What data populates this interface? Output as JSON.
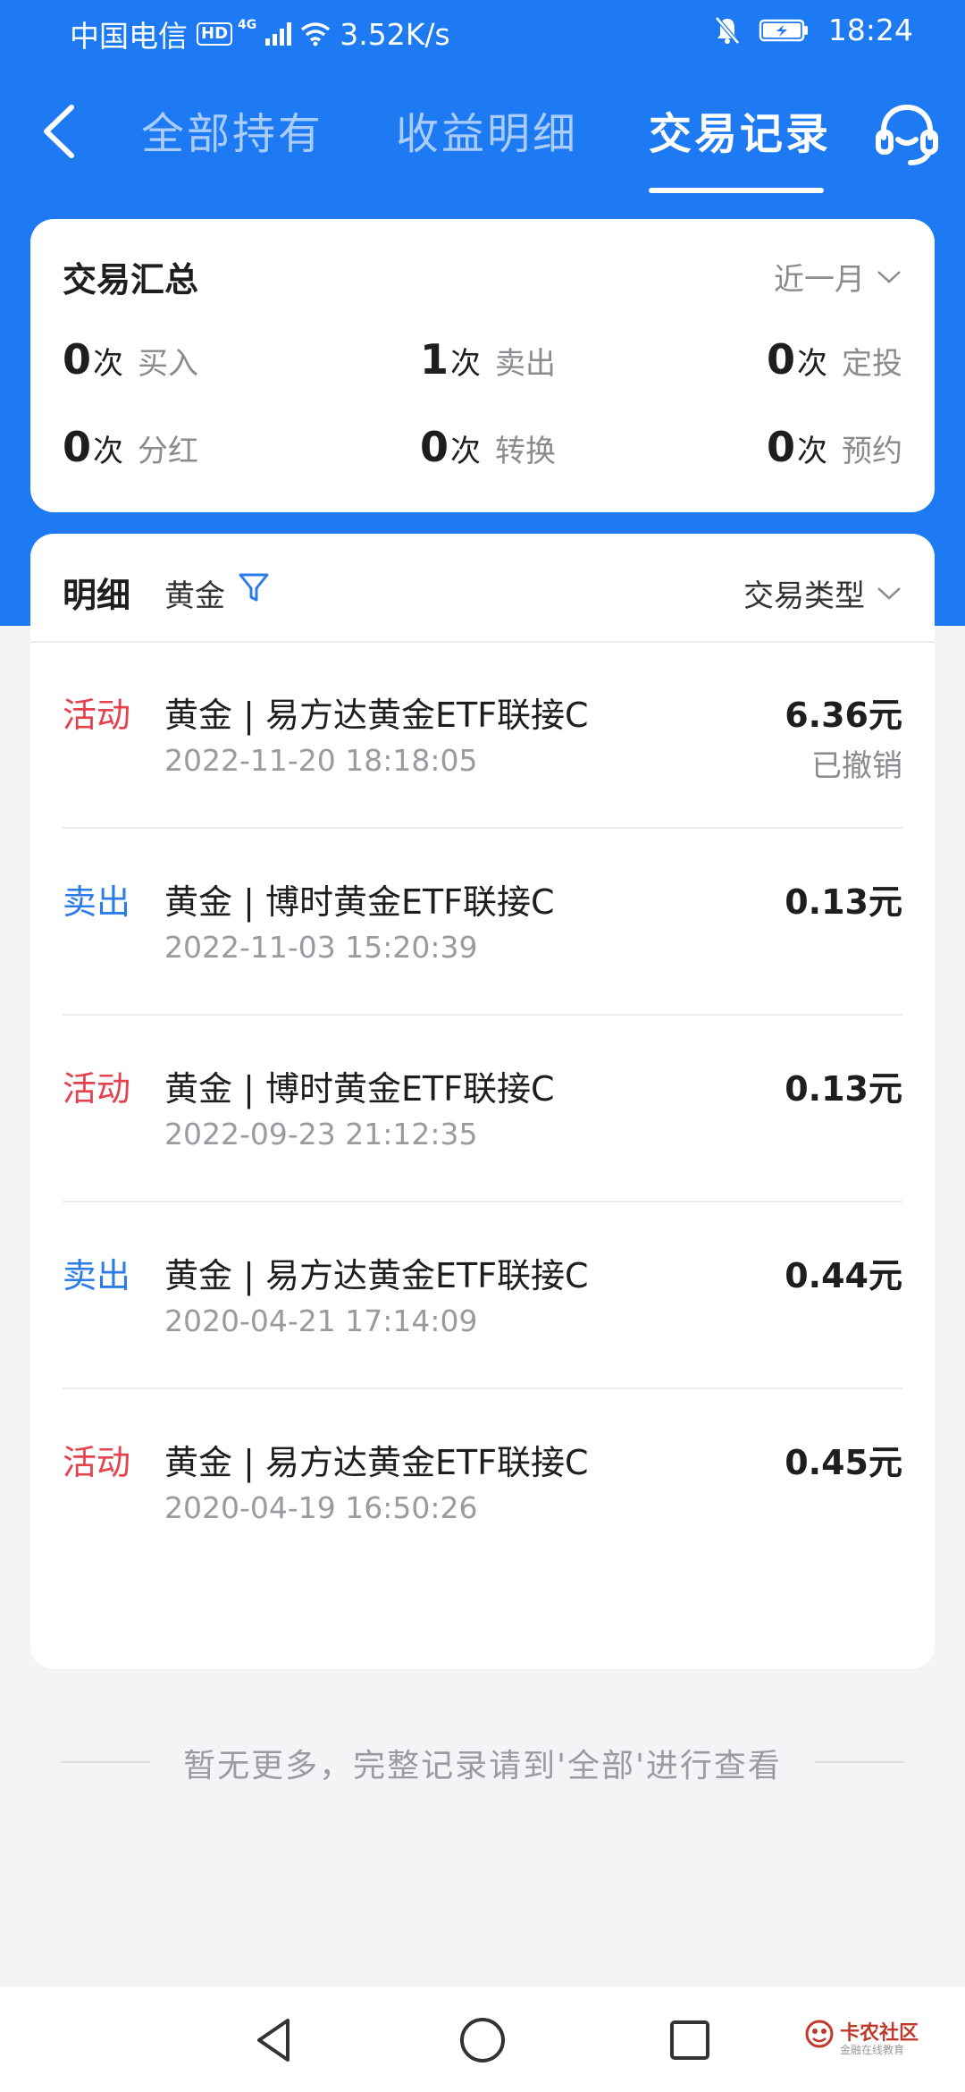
{
  "status_bar": {
    "carrier": "中国电信",
    "hd": "HD",
    "network": "4G",
    "speed": "3.52K/s",
    "time": "18:24"
  },
  "nav": {
    "tabs": [
      {
        "label": "全部持有",
        "active": false
      },
      {
        "label": "收益明细",
        "active": false
      },
      {
        "label": "交易记录",
        "active": true
      }
    ]
  },
  "summary": {
    "title": "交易汇总",
    "period": "近一月",
    "stats": [
      {
        "count": "0",
        "unit": "次",
        "label": "买入"
      },
      {
        "count": "1",
        "unit": "次",
        "label": "卖出"
      },
      {
        "count": "0",
        "unit": "次",
        "label": "定投"
      },
      {
        "count": "0",
        "unit": "次",
        "label": "分红"
      },
      {
        "count": "0",
        "unit": "次",
        "label": "转换"
      },
      {
        "count": "0",
        "unit": "次",
        "label": "预约"
      }
    ]
  },
  "detail": {
    "title": "明细",
    "filter": "黄金",
    "type_dropdown": "交易类型",
    "transactions": [
      {
        "type": "活动",
        "type_color": "#e5424d",
        "name": "黄金 | 易方达黄金ETF联接C",
        "time": "2022-11-20 18:18:05",
        "amount": "6.36元",
        "status": "已撤销"
      },
      {
        "type": "卖出",
        "type_color": "#2a7de8",
        "name": "黄金 | 博时黄金ETF联接C",
        "time": "2022-11-03 15:20:39",
        "amount": "0.13元",
        "status": ""
      },
      {
        "type": "活动",
        "type_color": "#e5424d",
        "name": "黄金 | 博时黄金ETF联接C",
        "time": "2022-09-23 21:12:35",
        "amount": "0.13元",
        "status": ""
      },
      {
        "type": "卖出",
        "type_color": "#2a7de8",
        "name": "黄金 | 易方达黄金ETF联接C",
        "time": "2020-04-21 17:14:09",
        "amount": "0.44元",
        "status": ""
      },
      {
        "type": "活动",
        "type_color": "#e5424d",
        "name": "黄金 | 易方达黄金ETF联接C",
        "time": "2020-04-19 16:50:26",
        "amount": "0.45元",
        "status": ""
      }
    ]
  },
  "footer_note": "暂无更多，完整记录请到'全部'进行查看",
  "watermark": {
    "title": "卡农社区",
    "subtitle": "金融在线教育"
  },
  "icons": {
    "back": "back-arrow-icon",
    "customer_service": "headset-icon",
    "filter": "filter-icon",
    "dropdown": "chevron-down-icon",
    "sys_back": "triangle-back-icon",
    "sys_home": "circle-home-icon",
    "sys_recent": "square-recent-icon"
  },
  "colors": {
    "primary": "#1d7af2",
    "activity": "#e5424d",
    "sell": "#2a7de8"
  }
}
